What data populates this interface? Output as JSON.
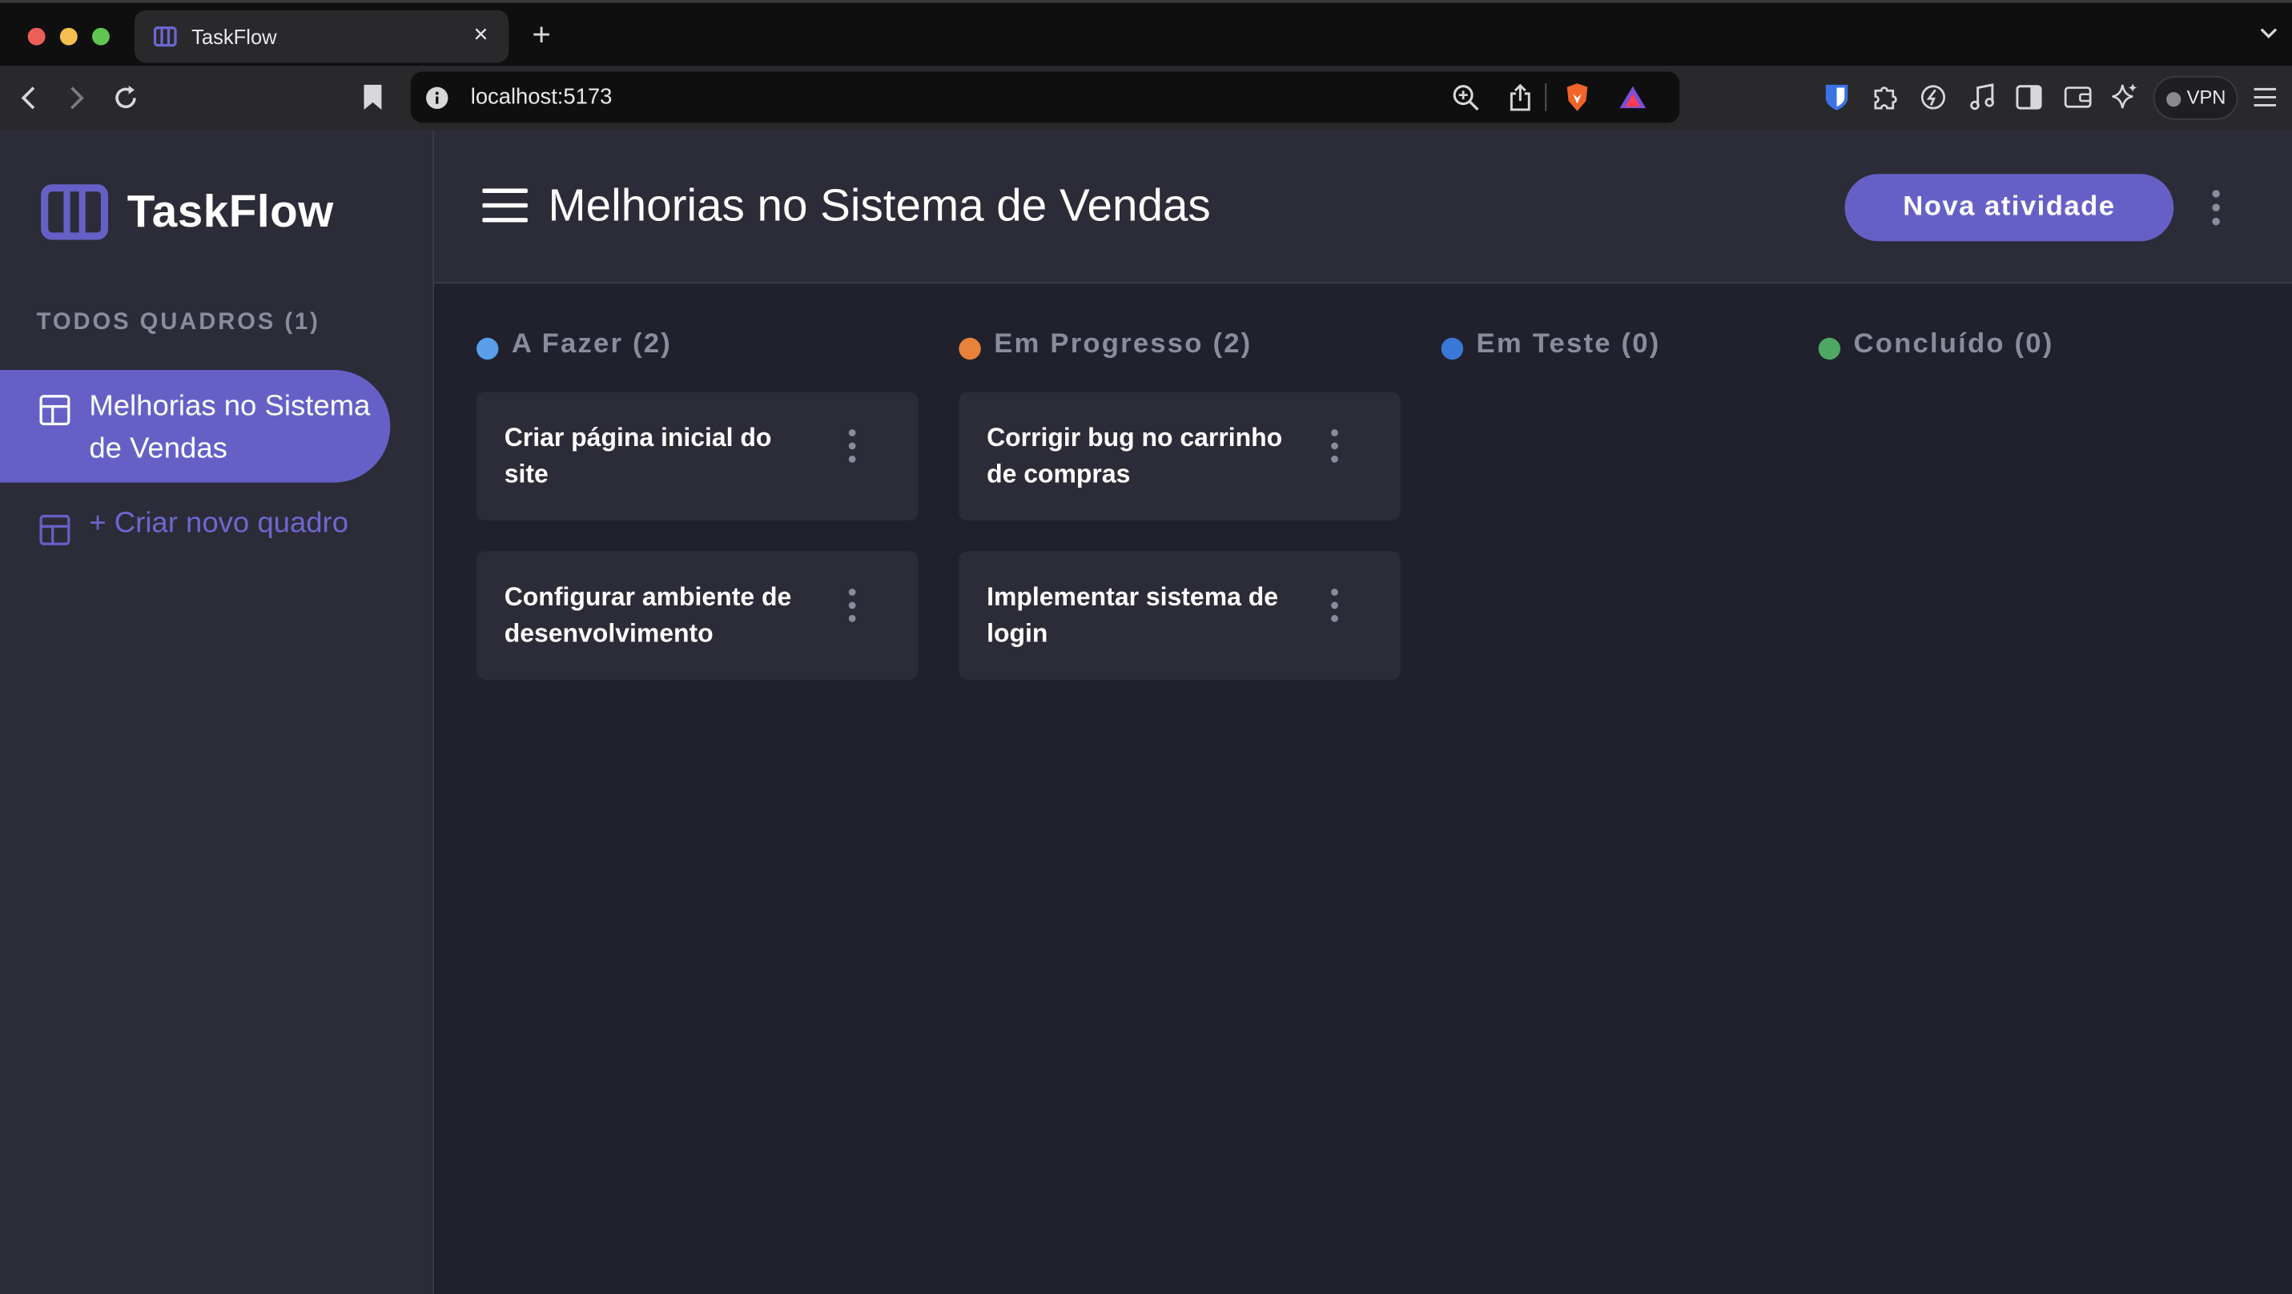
{
  "browser": {
    "tab_title": "TaskFlow",
    "tab_close": "×",
    "new_tab": "+",
    "url": "localhost:5173",
    "vpn_label": "VPN"
  },
  "sidebar": {
    "brand": "TaskFlow",
    "boards_heading": "TODOS QUADROS (1)",
    "boards": [
      {
        "label": "Melhorias no Sistema de Vendas",
        "active": true
      }
    ],
    "create_board_label": "+ Criar novo quadro"
  },
  "header": {
    "title": "Melhorias no Sistema de Vendas",
    "add_task_label": "Nova atividade"
  },
  "columns": [
    {
      "label": "A Fazer (2)",
      "color": "#5a9ee8",
      "cards": [
        "Criar página inicial do site",
        "Configurar ambiente de desenvolvimento"
      ]
    },
    {
      "label": "Em Progresso (2)",
      "color": "#e8823a",
      "cards": [
        "Corrigir bug no carrinho de compras",
        "Implementar sistema de login"
      ]
    },
    {
      "label": "Em Teste (0)",
      "color": "#3a78d8",
      "cards": []
    },
    {
      "label": "Concluído (0)",
      "color": "#4ea864",
      "cards": []
    }
  ],
  "colors": {
    "accent": "#6660c6",
    "sidebar_bg": "#2c2c38",
    "board_bg": "#20212c"
  }
}
